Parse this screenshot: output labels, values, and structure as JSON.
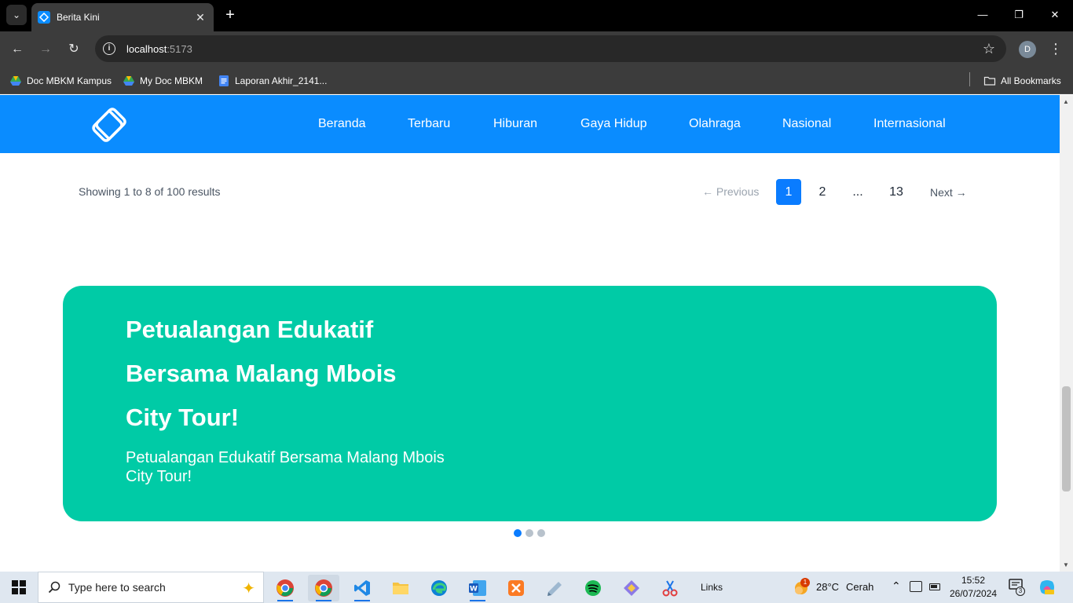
{
  "browser": {
    "tab_title": "Berita Kini",
    "url_host": "localhost",
    "url_port": ":5173",
    "profile_initial": "D",
    "bookmarks": [
      {
        "label": "Doc MBKM Kampus",
        "icon": "google-drive-icon"
      },
      {
        "label": "My Doc MBKM",
        "icon": "google-drive-icon"
      },
      {
        "label": "Laporan Akhir_2141...",
        "icon": "google-docs-icon"
      }
    ],
    "all_bookmarks_label": "All Bookmarks"
  },
  "site": {
    "brand_color": "#0a8cff",
    "nav": [
      "Beranda",
      "Terbaru",
      "Hiburan",
      "Gaya Hidup",
      "Olahraga",
      "Nasional",
      "Internasional"
    ]
  },
  "pagination": {
    "showing_text": "Showing 1 to 8 of 100 results",
    "previous_label": "← Previous",
    "pages": [
      "1",
      "2",
      "...",
      "13"
    ],
    "active_page": "1",
    "next_label": "Next →"
  },
  "banner": {
    "color": "#00cba6",
    "title_lines": [
      "Petualangan Edukatif",
      "Bersama Malang Mbois",
      "City Tour!"
    ],
    "subtitle": "Petualangan Edukatif Bersama Malang Mbois City Tour!",
    "slide_count": 3,
    "active_slide": 1
  },
  "taskbar": {
    "search_placeholder": "Type here to search",
    "links_label": "Links",
    "weather_temp": "28°C",
    "weather_text": "Cerah",
    "weather_badge": "1",
    "time": "15:52",
    "date": "26/07/2024",
    "notification_count": "3"
  }
}
